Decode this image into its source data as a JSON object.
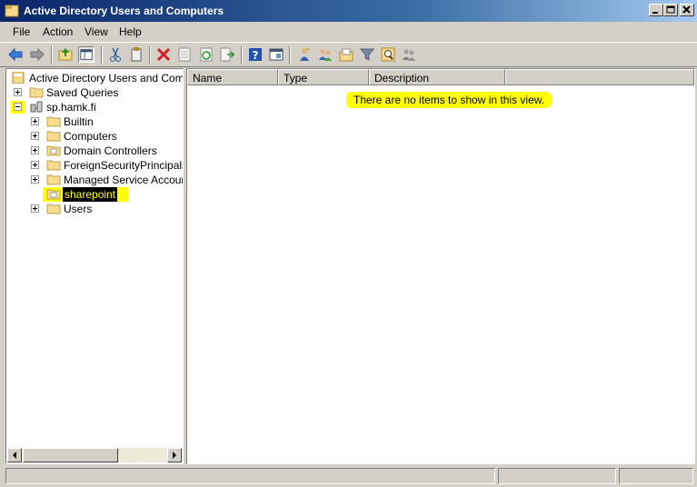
{
  "window": {
    "title": "Active Directory Users and Computers",
    "colors": {
      "title_start": "#0a246a",
      "title_end": "#a6caf0",
      "highlight": "#ffff00"
    }
  },
  "menu": [
    "File",
    "Action",
    "View",
    "Help"
  ],
  "toolbar": {
    "buttons": [
      "back-icon",
      "forward-icon",
      "up-folder-icon",
      "show-hide-tree-icon",
      "cut-icon",
      "copy-icon",
      "delete-icon",
      "properties-icon",
      "refresh-icon",
      "export-list-icon",
      "help-icon",
      "view-icon",
      "new-user-icon",
      "new-group-icon",
      "new-ou-icon",
      "filter-icon",
      "find-icon",
      "add-to-group-icon"
    ]
  },
  "tree": {
    "root": "Active Directory Users and Comput",
    "saved_queries": "Saved Queries",
    "domain": "sp.hamk.fi",
    "children": [
      "Builtin",
      "Computers",
      "Domain Controllers",
      "ForeignSecurityPrincipals",
      "Managed Service Accounts",
      "sharepoint",
      "Users"
    ]
  },
  "list": {
    "columns": [
      "Name",
      "Type",
      "Description"
    ],
    "empty_message": "There are no items to show in this view."
  }
}
